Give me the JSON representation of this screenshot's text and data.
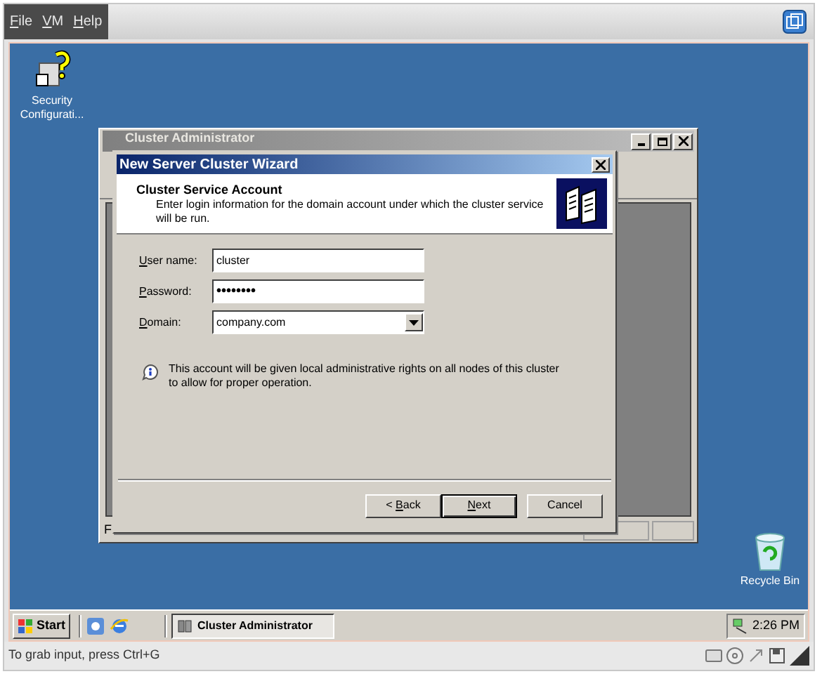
{
  "vm_menu": [
    {
      "key": "F",
      "rest": "ile"
    },
    {
      "key": "V",
      "rest": "M"
    },
    {
      "key": "H",
      "rest": "elp"
    }
  ],
  "desktop_icons": [
    {
      "kind": "security",
      "label": "Security Configurati..."
    },
    {
      "kind": "recycle",
      "label": "Recycle Bin"
    }
  ],
  "background_window": {
    "title": "Cluster Administrator",
    "status": "F"
  },
  "wizard": {
    "title": "New Server Cluster Wizard",
    "heading": "Cluster Service Account",
    "subtitle": "Enter login information for the domain account under which the cluster service will be run.",
    "fields": [
      {
        "kind": "text",
        "label": {
          "key": "U",
          "rest": "ser name:"
        },
        "value": "cluster"
      },
      {
        "kind": "password",
        "label": {
          "key": "P",
          "rest": "assword:"
        },
        "value": "••••••••"
      },
      {
        "kind": "dropdown",
        "label": {
          "key": "D",
          "rest": "omain:"
        },
        "value": "company.com"
      }
    ],
    "note": "This account will be given local administrative rights on all nodes of this cluster to allow for proper operation.",
    "buttons": [
      {
        "before": "< ",
        "key": "B",
        "rest": "ack",
        "default": false
      },
      {
        "key": "N",
        "rest": "ext",
        "default": true
      },
      {
        "rest": "Cancel",
        "default": false
      }
    ]
  },
  "taskbar": {
    "start": "Start",
    "tasks": [
      {
        "label": "Cluster Administrator",
        "selected": true
      }
    ],
    "clock": "2:26 PM"
  },
  "status_bar": {
    "text": "To grab input, press Ctrl+G"
  }
}
